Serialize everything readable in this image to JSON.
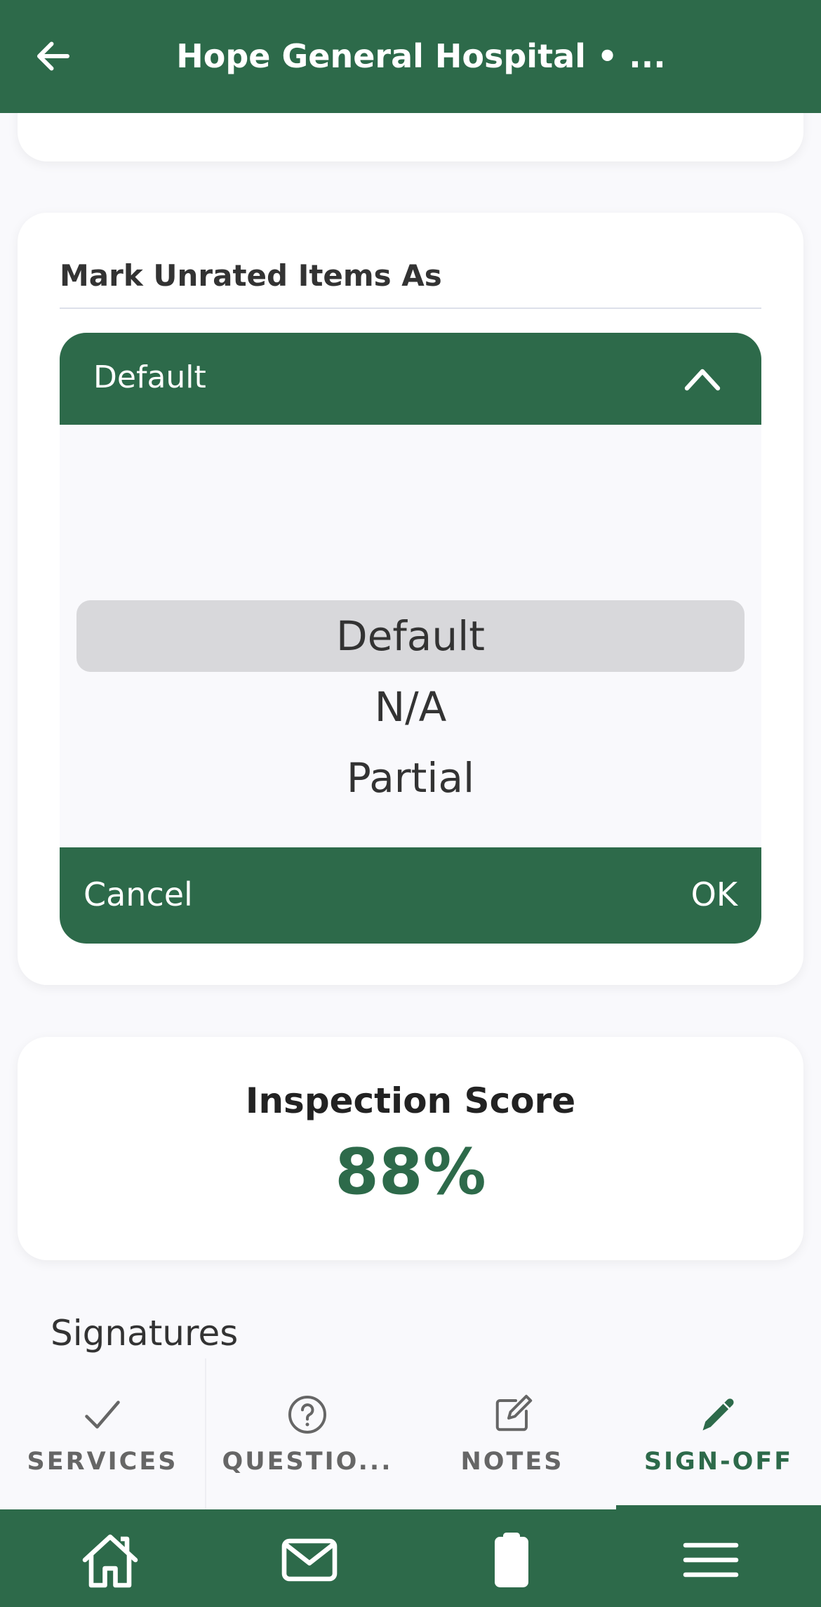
{
  "header": {
    "title": "Hope General Hospital • ...",
    "back_icon": "arrow-left-icon"
  },
  "mark_unrated": {
    "title": "Mark Unrated Items As",
    "selected_value": "Default",
    "options": [
      "Default",
      "N/A",
      "Partial"
    ],
    "cancel_label": "Cancel",
    "ok_label": "OK"
  },
  "score": {
    "label": "Inspection Score",
    "value": "88%"
  },
  "signatures": {
    "label": "Signatures"
  },
  "tabs": [
    {
      "label": "SERVICES",
      "icon": "check-icon",
      "active": false
    },
    {
      "label": "QUESTIO...",
      "icon": "question-circle-icon",
      "active": false
    },
    {
      "label": "NOTES",
      "icon": "edit-note-icon",
      "active": false
    },
    {
      "label": "SIGN-OFF",
      "icon": "pencil-icon",
      "active": true
    }
  ],
  "bottom_nav": [
    {
      "icon": "home-icon"
    },
    {
      "icon": "mail-icon"
    },
    {
      "icon": "clipboard-icon"
    },
    {
      "icon": "menu-icon"
    }
  ],
  "colors": {
    "brand_green": "#2d6a4a",
    "background": "#f9f9fc",
    "picker_selection": "#d8d8db"
  }
}
